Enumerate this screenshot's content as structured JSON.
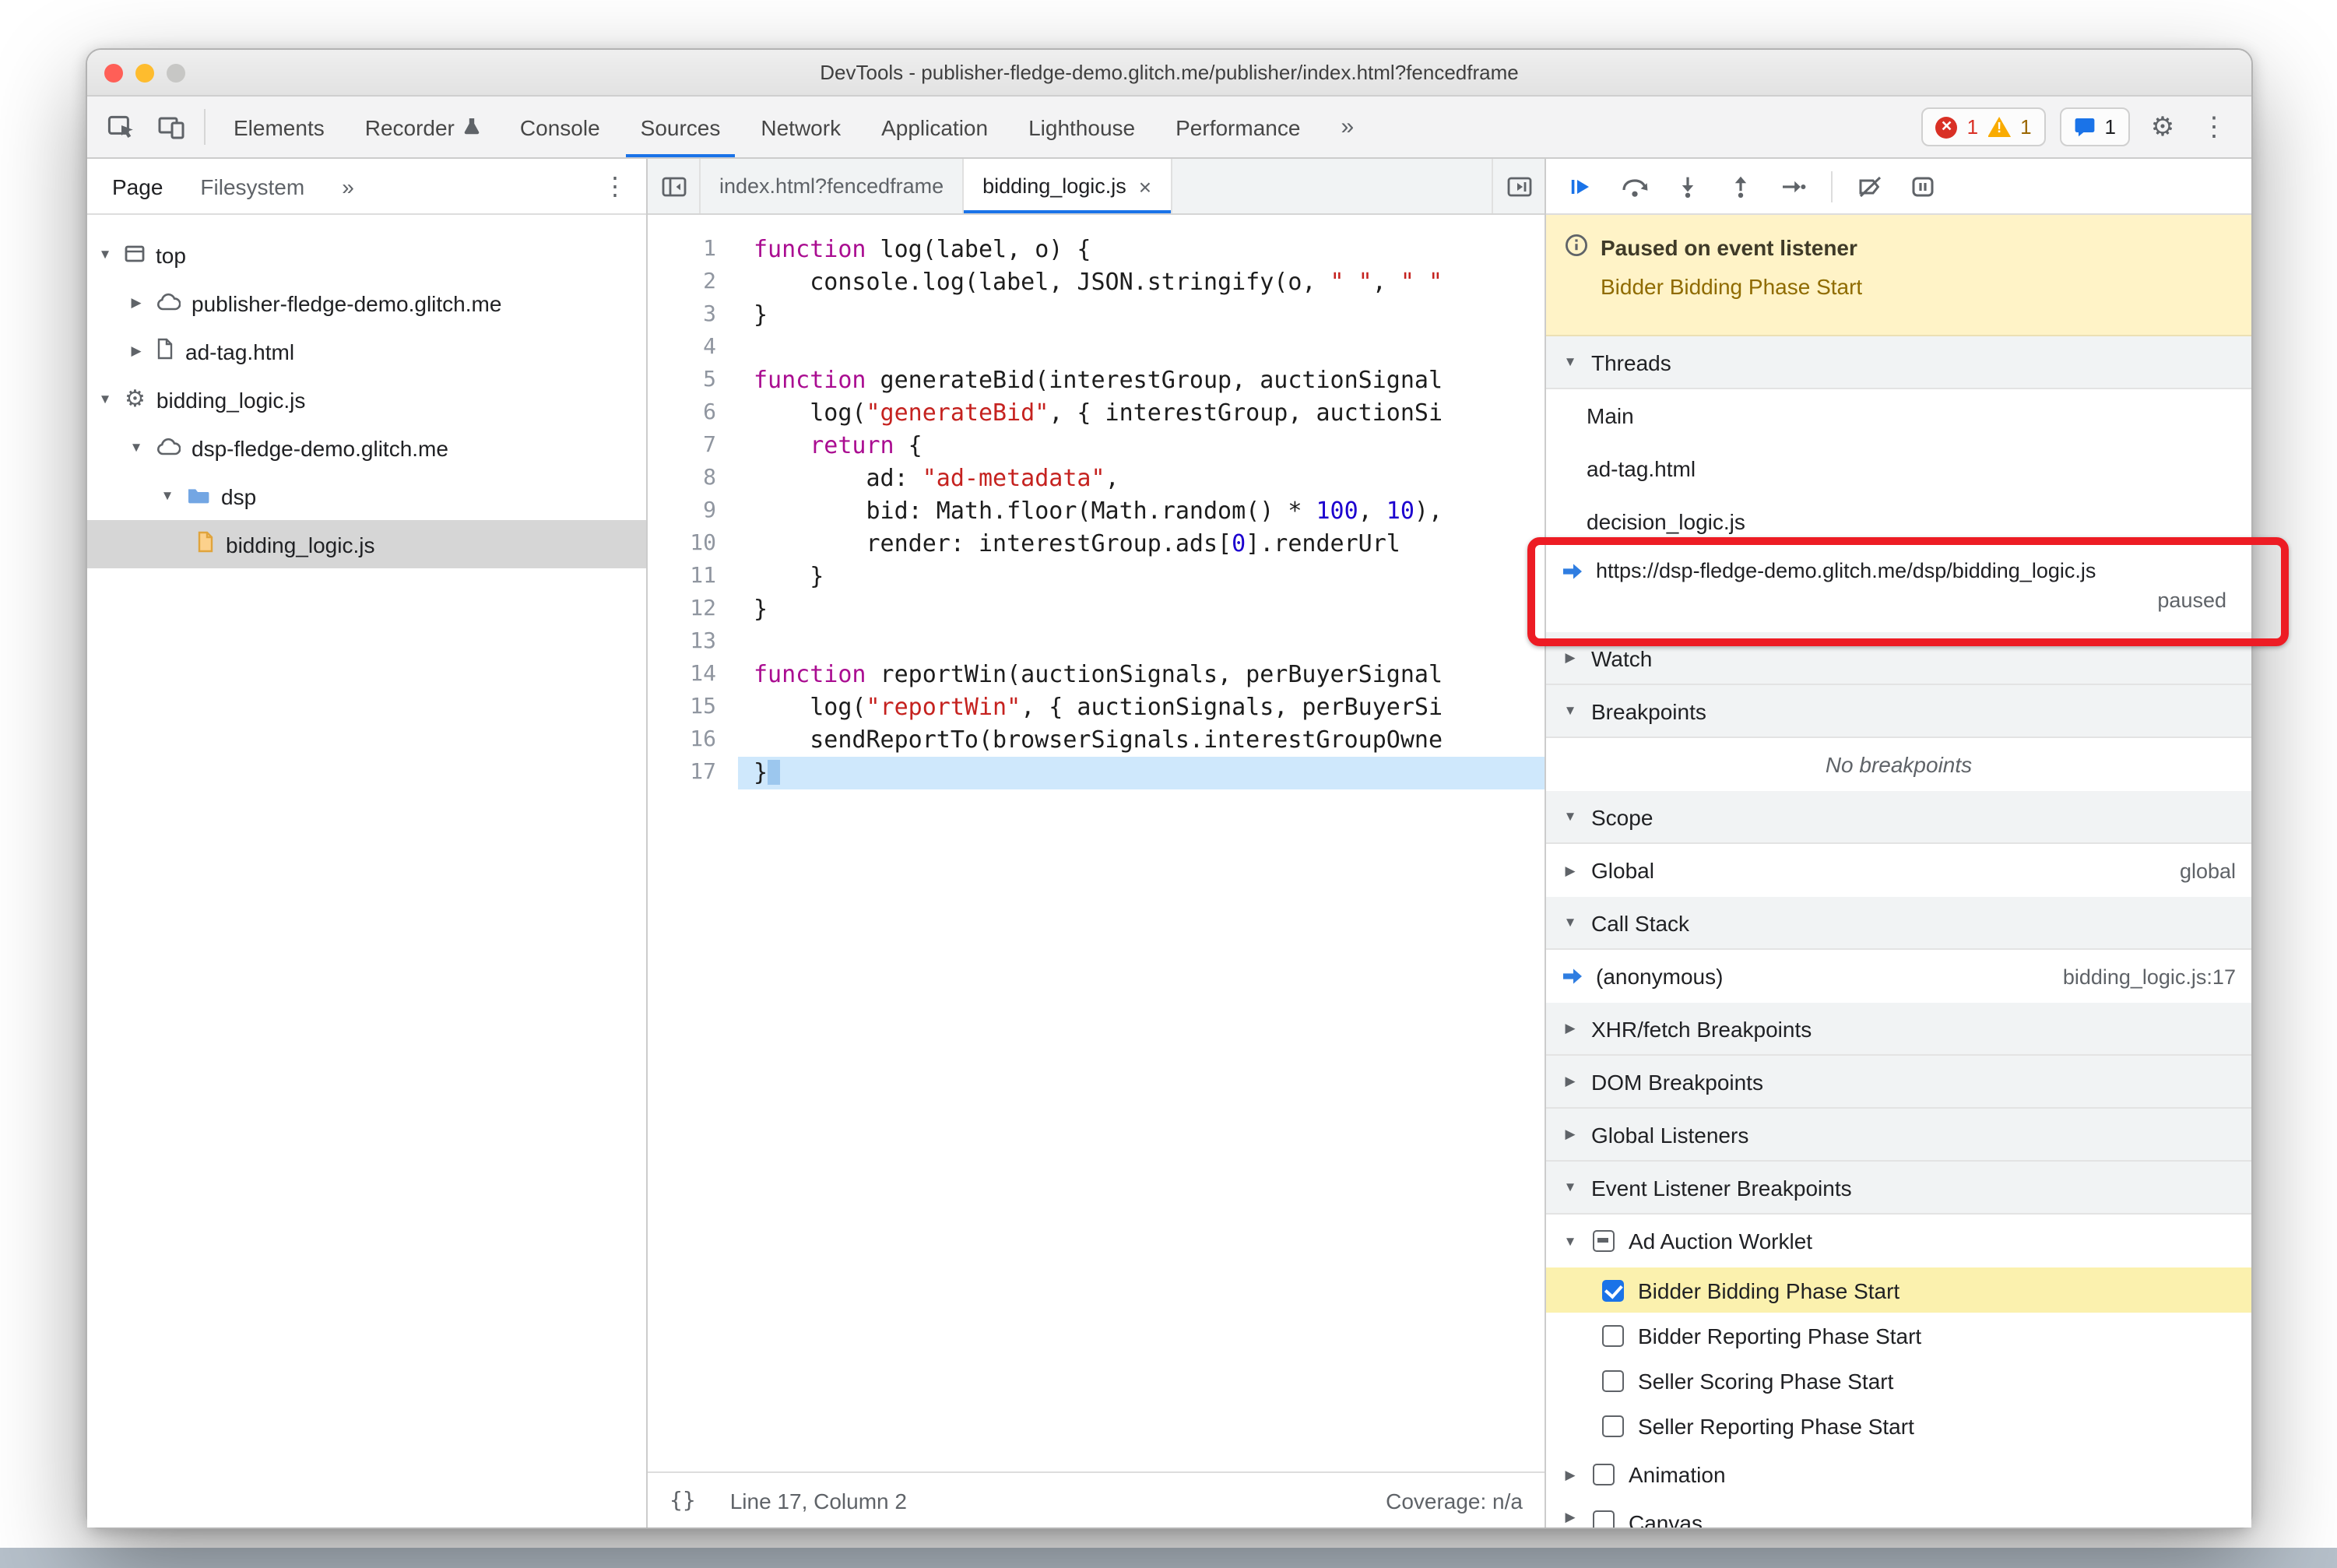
{
  "window": {
    "title": "DevTools - publisher-fledge-demo.glitch.me/publisher/index.html?fencedframe"
  },
  "icons": {
    "triangle_down": "▼",
    "triangle_right": "▶",
    "gear": "⚙",
    "kebab": "⋮",
    "more": "»"
  },
  "toolbar": {
    "tabs": [
      "Elements",
      "Recorder",
      "Console",
      "Sources",
      "Network",
      "Application",
      "Lighthouse",
      "Performance"
    ],
    "active_tab": "Sources",
    "overflow": "»",
    "badges": {
      "errors": "1",
      "warnings": "1",
      "issues": "1"
    }
  },
  "sidebar": {
    "tabs": {
      "page": "Page",
      "filesystem": "Filesystem",
      "overflow": "»"
    },
    "tree": [
      {
        "label": "top"
      },
      {
        "label": "publisher-fledge-demo.glitch.me"
      },
      {
        "label": "ad-tag.html"
      },
      {
        "label": "bidding_logic.js"
      },
      {
        "label": "dsp-fledge-demo.glitch.me"
      },
      {
        "label": "dsp"
      },
      {
        "label": "bidding_logic.js",
        "selected": true
      }
    ]
  },
  "editor": {
    "tabs": [
      {
        "label": "index.html?fencedframe"
      },
      {
        "label": "bidding_logic.js",
        "close": "×",
        "active": true
      }
    ],
    "code": {
      "lines": [
        {
          "t": [
            [
              "k",
              "function"
            ],
            [
              "d",
              " log(label, o) {"
            ]
          ]
        },
        {
          "t": [
            [
              "d",
              "    console.log(label, JSON.stringify(o, "
            ],
            [
              "s",
              "\" \""
            ],
            [
              "d",
              ", "
            ],
            [
              "s",
              "\" \""
            ]
          ]
        },
        {
          "t": [
            [
              "d",
              "}"
            ]
          ]
        },
        {
          "t": []
        },
        {
          "t": [
            [
              "k",
              "function"
            ],
            [
              "d",
              " generateBid(interestGroup, auctionSignal"
            ]
          ]
        },
        {
          "t": [
            [
              "d",
              "    log("
            ],
            [
              "s",
              "\"generateBid\""
            ],
            [
              "d",
              ", { interestGroup, auctionSi"
            ]
          ]
        },
        {
          "t": [
            [
              "d",
              "    "
            ],
            [
              "k",
              "return"
            ],
            [
              "d",
              " {"
            ]
          ]
        },
        {
          "t": [
            [
              "d",
              "        ad: "
            ],
            [
              "s",
              "\"ad-metadata\""
            ],
            [
              "d",
              ","
            ]
          ]
        },
        {
          "t": [
            [
              "d",
              "        bid: Math.floor(Math.random() * "
            ],
            [
              "n",
              "100"
            ],
            [
              "d",
              ", "
            ],
            [
              "n",
              "10"
            ],
            [
              "d",
              "),"
            ]
          ]
        },
        {
          "t": [
            [
              "d",
              "        render: interestGroup.ads["
            ],
            [
              "n",
              "0"
            ],
            [
              "d",
              "].renderUrl"
            ]
          ]
        },
        {
          "t": [
            [
              "d",
              "    }"
            ]
          ]
        },
        {
          "t": [
            [
              "d",
              "}"
            ]
          ]
        },
        {
          "t": []
        },
        {
          "t": [
            [
              "k",
              "function"
            ],
            [
              "d",
              " reportWin(auctionSignals, perBuyerSignal"
            ]
          ]
        },
        {
          "t": [
            [
              "d",
              "    log("
            ],
            [
              "s",
              "\"reportWin\""
            ],
            [
              "d",
              ", { auctionSignals, perBuyerSi"
            ]
          ]
        },
        {
          "t": [
            [
              "d",
              "    sendReportTo(browserSignals.interestGroupOwne"
            ]
          ]
        },
        {
          "t": [
            [
              "d",
              "}"
            ]
          ],
          "hl": true
        }
      ]
    },
    "statusbar": {
      "pretty_print": "{}",
      "position": "Line 17, Column 2",
      "coverage": "Coverage: n/a"
    }
  },
  "debugger": {
    "paused": {
      "title": "Paused on event listener",
      "reason": "Bidder Bidding Phase Start"
    },
    "threads": {
      "header": "Threads",
      "items": [
        "Main",
        "ad-tag.html",
        "decision_logic.js"
      ],
      "active": {
        "url": "https://dsp-fledge-demo.glitch.me/dsp/bidding_logic.js",
        "status": "paused"
      }
    },
    "watch": {
      "header": "Watch"
    },
    "breakpoints": {
      "header": "Breakpoints",
      "empty": "No breakpoints"
    },
    "scope": {
      "header": "Scope",
      "rows": [
        {
          "label": "Global",
          "value": "global"
        }
      ]
    },
    "call_stack": {
      "header": "Call Stack",
      "frames": [
        {
          "label": "(anonymous)",
          "location": "bidding_logic.js:17"
        }
      ]
    },
    "xhr_breakpoints": {
      "header": "XHR/fetch Breakpoints"
    },
    "dom_breakpoints": {
      "header": "DOM Breakpoints"
    },
    "global_listeners": {
      "header": "Global Listeners"
    },
    "event_listener_breakpoints": {
      "header": "Event Listener Breakpoints",
      "groups": [
        {
          "label": "Ad Auction Worklet",
          "checked": "indeterminate",
          "expanded": true,
          "children": [
            {
              "label": "Bidder Bidding Phase Start",
              "checked": true,
              "highlighted": true
            },
            {
              "label": "Bidder Reporting Phase Start",
              "checked": false
            },
            {
              "label": "Seller Scoring Phase Start",
              "checked": false
            },
            {
              "label": "Seller Reporting Phase Start",
              "checked": false
            }
          ]
        },
        {
          "label": "Animation",
          "checked": false,
          "expanded": false
        },
        {
          "label": "Canvas",
          "checked": false,
          "expanded": false
        }
      ]
    }
  },
  "colors": {
    "accent": "#1a73e8",
    "annotation_red": "#ed1c24",
    "paused_banner_bg": "#fff3c7",
    "selected_breakpoint_bg": "#fbf1ae",
    "execution_line_bg": "#cfe8fc",
    "error_red": "#d93025",
    "warning_yellow": "#f9ab00"
  }
}
